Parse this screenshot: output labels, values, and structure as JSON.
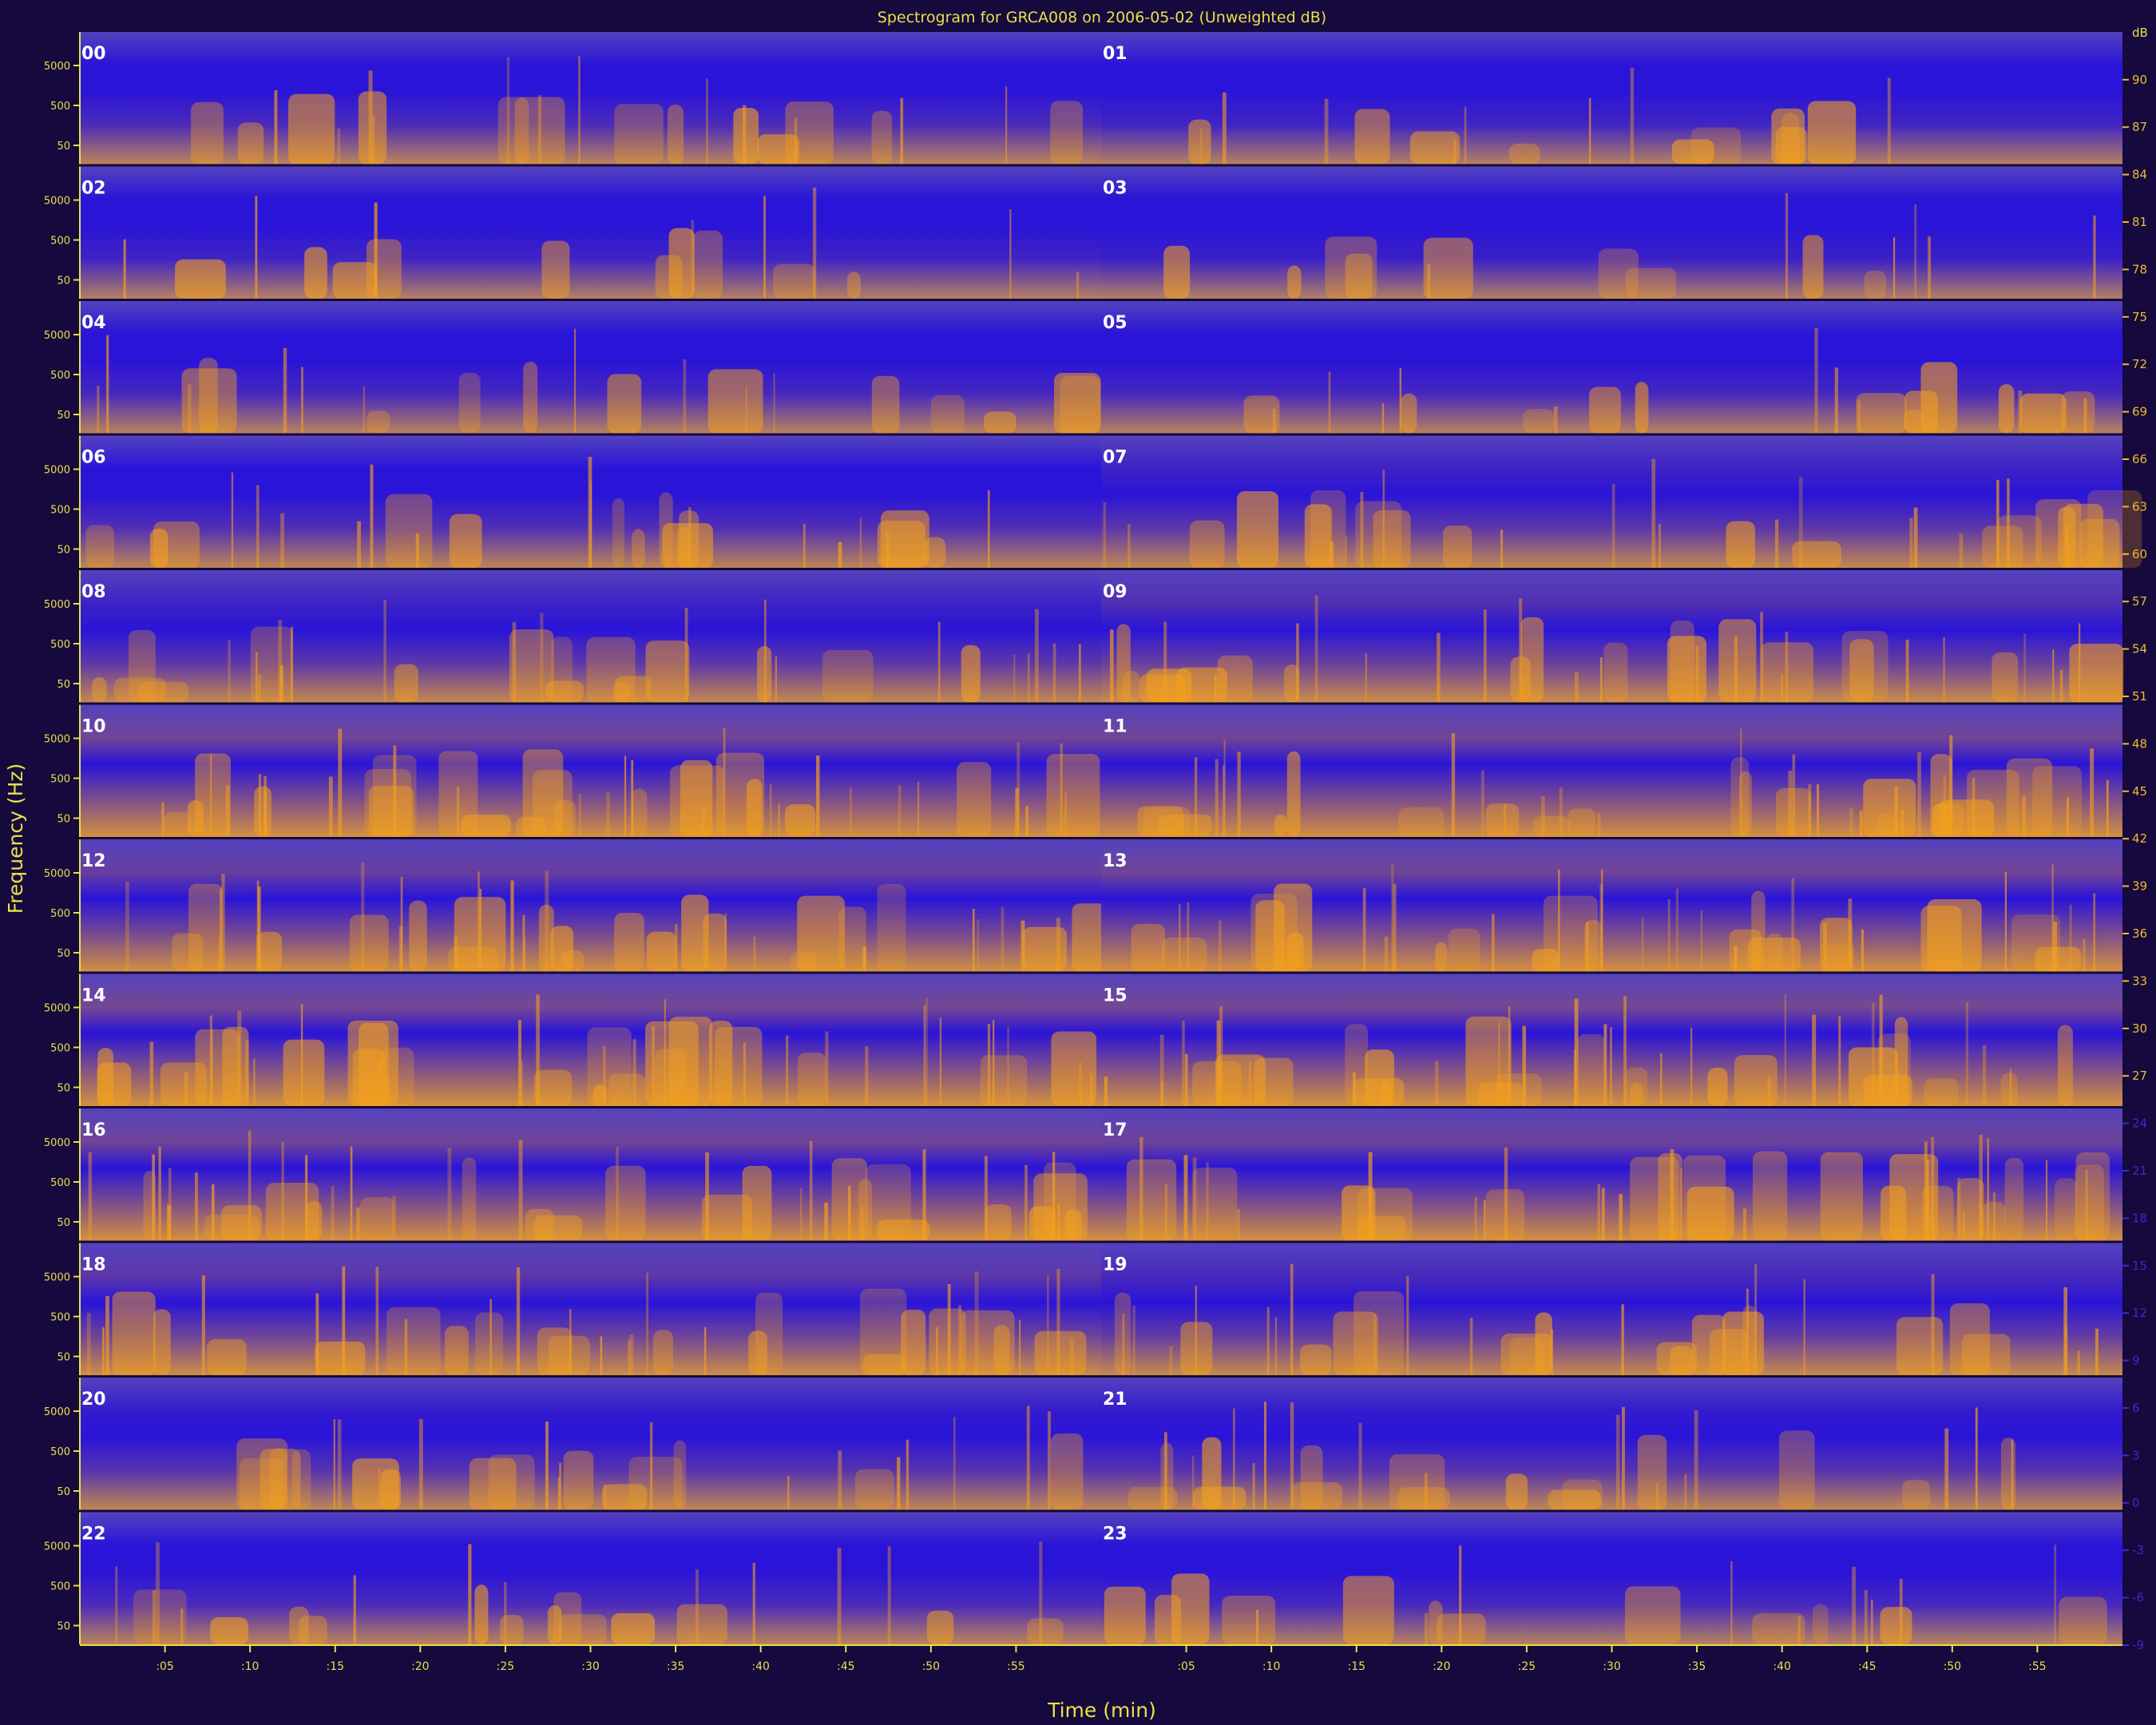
{
  "colors": {
    "background": "#15093d",
    "low_energy": "#2a14d8",
    "mid_energy": "#6b5ab0",
    "high_energy": "#f4a11c",
    "axis": "#e8e04a",
    "hour_label": "#ffffff"
  },
  "chart_data": {
    "type": "heatmap",
    "title": "Spectrogram for GRCA008 on 2006-05-02 (Unweighted dB)",
    "xlabel": "Time (min)",
    "ylabel": "Frequency (Hz)",
    "row_count": 12,
    "hours_per_row": 2,
    "hour_labels": [
      "00",
      "01",
      "02",
      "03",
      "04",
      "05",
      "06",
      "07",
      "08",
      "09",
      "10",
      "11",
      "12",
      "13",
      "14",
      "15",
      "16",
      "17",
      "18",
      "19",
      "20",
      "21",
      "22",
      "23"
    ],
    "y_tick_labels": [
      "5000",
      "500",
      "50"
    ],
    "x_tick_labels": [
      ":05",
      ":10",
      ":15",
      ":20",
      ":25",
      ":30",
      ":35",
      ":40",
      ":45",
      ":50",
      ":55",
      ":05",
      ":10",
      ":15",
      ":20",
      ":25",
      ":30",
      ":35",
      ":40",
      ":45",
      ":50",
      ":55"
    ],
    "colorbar": {
      "label": "dB",
      "range": [
        -9,
        91
      ],
      "ticks": [
        90,
        87,
        84,
        81,
        78,
        75,
        72,
        69,
        66,
        63,
        60,
        57,
        54,
        51,
        48,
        45,
        42,
        39,
        36,
        33,
        30,
        27,
        24,
        21,
        18,
        15,
        12,
        9,
        6,
        3,
        0,
        -3,
        -6,
        -9
      ]
    },
    "acoustic_activity_by_hour": [
      {
        "hour": "00",
        "level": 0.3
      },
      {
        "hour": "01",
        "level": 0.2
      },
      {
        "hour": "02",
        "level": 0.2
      },
      {
        "hour": "03",
        "level": 0.15
      },
      {
        "hour": "04",
        "level": 0.25
      },
      {
        "hour": "05",
        "level": 0.25
      },
      {
        "hour": "06",
        "level": 0.35
      },
      {
        "hour": "07",
        "level": 0.45
      },
      {
        "hour": "08",
        "level": 0.45
      },
      {
        "hour": "09",
        "level": 0.55
      },
      {
        "hour": "10",
        "level": 0.7
      },
      {
        "hour": "11",
        "level": 0.7
      },
      {
        "hour": "12",
        "level": 0.65
      },
      {
        "hour": "13",
        "level": 0.7
      },
      {
        "hour": "14",
        "level": 0.72
      },
      {
        "hour": "15",
        "level": 0.72
      },
      {
        "hour": "16",
        "level": 0.7
      },
      {
        "hour": "17",
        "level": 0.68
      },
      {
        "hour": "18",
        "level": 0.6
      },
      {
        "hour": "19",
        "level": 0.5
      },
      {
        "hour": "20",
        "level": 0.4
      },
      {
        "hour": "21",
        "level": 0.4
      },
      {
        "hour": "22",
        "level": 0.3
      },
      {
        "hour": "23",
        "level": 0.25
      }
    ]
  }
}
